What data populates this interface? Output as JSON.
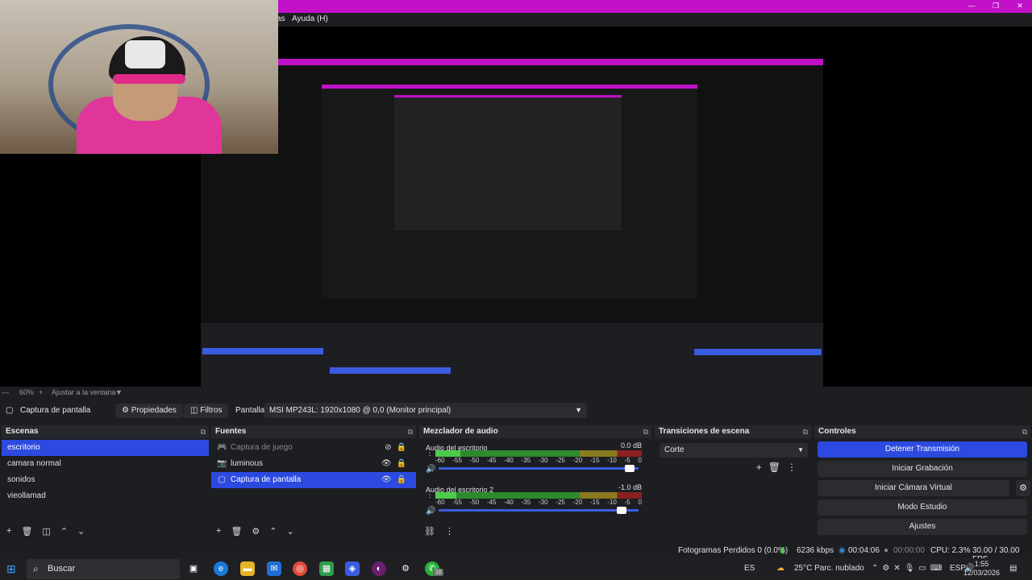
{
  "menu": {
    "partial": "as",
    "help": "Ayuda (H)"
  },
  "window_controls": {
    "minimize": "—",
    "maximize": "❐",
    "close": "✕"
  },
  "zoom": {
    "percent": "60%",
    "fit_label": "Ajustar a la ventana"
  },
  "source_toolbar": {
    "source_name": "Captura de pantalla",
    "properties_label": "Propiedades",
    "filters_label": "Filtros",
    "display_label": "Pantalla",
    "display_value": "MSI MP243L: 1920x1080 @ 0,0 (Monitor principal)"
  },
  "scenes": {
    "title": "Escenas",
    "items": [
      {
        "label": "escritorio",
        "active": true
      },
      {
        "label": "camara normal",
        "active": false
      },
      {
        "label": "sonidos",
        "active": false
      },
      {
        "label": "vieollamad",
        "active": false
      }
    ]
  },
  "sources": {
    "title": "Fuentes",
    "items": [
      {
        "label": "Captura de juego",
        "icon": "game-capture-icon",
        "active": false,
        "dim": true
      },
      {
        "label": "luminous",
        "icon": "camera-icon",
        "active": false,
        "dim": false
      },
      {
        "label": "Captura de pantalla",
        "icon": "monitor-icon",
        "active": true,
        "dim": false
      }
    ]
  },
  "mixer": {
    "title": "Mezclador de audio",
    "channels": [
      {
        "name": "Audio del escritorio",
        "db": "0.0 dB",
        "level": 0.12,
        "volume": 0.98
      },
      {
        "name": "Audio del escritorio 2",
        "db": "-1.0 dB",
        "level": 0.1,
        "volume": 0.94
      }
    ],
    "scale": [
      "-60",
      "-55",
      "-50",
      "-45",
      "-40",
      "-35",
      "-30",
      "-25",
      "-20",
      "-15",
      "-10",
      "-5",
      "0"
    ]
  },
  "transitions": {
    "title": "Transiciones de escena",
    "selected": "Corte"
  },
  "controls": {
    "title": "Controles",
    "stop_stream": "Detener Transmisión",
    "start_recording": "Iniciar Grabación",
    "start_virtual_cam": "Iniciar Cámara Virtual",
    "studio_mode": "Modo Estudio",
    "settings": "Ajustes"
  },
  "status": {
    "dropped_frames": "Fotogramas Perdidos 0 (0.0%)",
    "bitrate": "6236 kbps",
    "stream_time": "00:04:06",
    "rec_time": "00:00:00",
    "cpu": "CPU: 2.3%",
    "fps": "30.00 / 30.00 FPS"
  },
  "taskbar": {
    "search_placeholder": "Buscar",
    "language": "ES",
    "weather": "25°C  Parc. nublado",
    "input_lang": "ESP",
    "time": "1:55",
    "date": "12/03/2026",
    "badge": "38"
  },
  "colors": {
    "accent": "#2c4ae0",
    "titlebar": "#c010c8",
    "background": "#1d1e22"
  }
}
